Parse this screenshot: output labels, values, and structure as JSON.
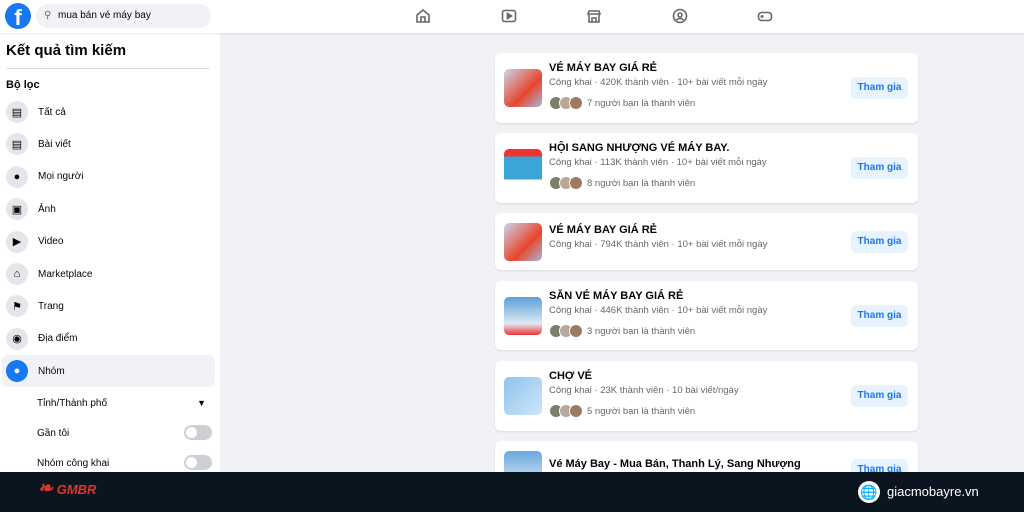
{
  "header": {
    "search_value": "mua bán vé máy bay",
    "nav_icons": [
      "home-icon",
      "video-icon",
      "marketplace-icon",
      "groups-icon",
      "gaming-icon"
    ]
  },
  "sidebar": {
    "title": "Kết quả tìm kiếm",
    "filters_label": "Bộ lọc",
    "items": [
      {
        "label": "Tất cả",
        "icon": "all-icon"
      },
      {
        "label": "Bài viết",
        "icon": "posts-icon"
      },
      {
        "label": "Mọi người",
        "icon": "people-icon"
      },
      {
        "label": "Ảnh",
        "icon": "photos-icon"
      },
      {
        "label": "Video",
        "icon": "video-icon"
      },
      {
        "label": "Marketplace",
        "icon": "marketplace-icon"
      },
      {
        "label": "Trang",
        "icon": "flag-icon"
      },
      {
        "label": "Địa điểm",
        "icon": "location-icon"
      },
      {
        "label": "Nhóm",
        "icon": "groups-icon",
        "active": true
      }
    ],
    "sub": {
      "province": "Tỉnh/Thành phố",
      "near": "Gần tôi",
      "public": "Nhóm công khai",
      "near_on": false,
      "public_on": false
    }
  },
  "results": [
    {
      "title": "VÉ MÁY BAY GIÁ RẺ",
      "meta": "Công khai · 420K thành viên · 10+ bài viết mỗi ngày",
      "friends": "7 người bạn là thành viên",
      "join": "Tham gia"
    },
    {
      "title": "HỘI SANG NHƯỢNG VÉ MÁY BAY.",
      "meta": "Công khai · 113K thành viên · 10+ bài viết mỗi ngày",
      "friends": "8 người bạn là thành viên",
      "join": "Tham gia"
    },
    {
      "title": "VÉ MÁY BAY GIÁ RẺ",
      "meta": "Công khai · 794K thành viên · 10+ bài viết mỗi ngày",
      "friends": "",
      "join": "Tham gia"
    },
    {
      "title": "SĂN VÉ MÁY BAY GIÁ RẺ",
      "meta": "Công khai · 446K thành viên · 10+ bài viết mỗi ngày",
      "friends": "3 người bạn là thành viên",
      "join": "Tham gia"
    },
    {
      "title": "CHỢ VÉ",
      "meta": "Công khai · 23K thành viên · 10 bài viết/ngày",
      "friends": "5 người bạn là thành viên",
      "join": "Tham gia"
    },
    {
      "title": "Vé Máy Bay - Mua Bán, Thanh Lý, Sang Nhượng",
      "meta": "",
      "friends": "",
      "join": "Tham gia"
    }
  ],
  "footer": {
    "logo": "GMBR",
    "site": "giacmobayre.vn"
  }
}
